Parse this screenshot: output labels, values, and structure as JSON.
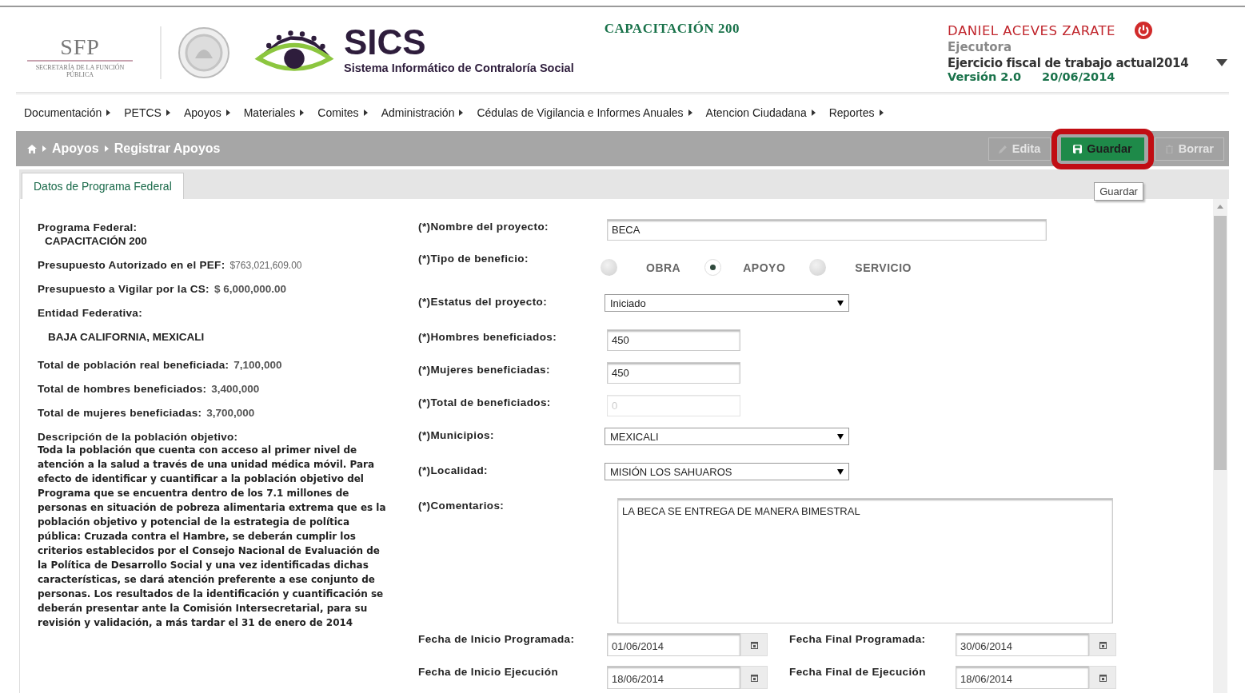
{
  "header": {
    "agency": "SFP",
    "agency_subtitle": "SECRETARÍA DE LA FUNCIÓN PÚBLICA",
    "app_name": "SICS",
    "app_subtitle": "Sistema Informático de Contraloría Social",
    "program": "CAPACITACIÓN 200",
    "user": {
      "name": "DANIEL ACEVES ZARATE",
      "role": "Ejecutora",
      "fiscal_year": "Ejercicio fiscal de trabajo actual2014",
      "version": "Versión 2.0",
      "date": "20/06/2014"
    }
  },
  "menu": [
    "Documentación",
    "PETCS",
    "Apoyos",
    "Materiales",
    "Comites",
    "Administración",
    "Cédulas de Vigilancia e Informes Anuales",
    "Atencion Ciudadana",
    "Reportes"
  ],
  "breadcrumb": [
    "Apoyos",
    "Registrar Apoyos"
  ],
  "toolbar": [
    {
      "kind": "edit",
      "label": "Edita",
      "disabled": true,
      "highlighted": false
    },
    {
      "kind": "save",
      "label": "Guardar",
      "disabled": false,
      "highlighted": true
    },
    {
      "kind": "delete",
      "label": "Borrar",
      "disabled": true,
      "highlighted": false
    }
  ],
  "tooltip": "Guardar",
  "tabs": [
    {
      "label": "Datos de Programa Federal",
      "selected": true
    }
  ],
  "summary": {
    "program_label": "Programa Federal:",
    "program_value": "CAPACITACIÓN 200",
    "items": [
      {
        "label": "Presupuesto Autorizado en el PEF:",
        "value": "$763,021,609.00"
      },
      {
        "label": "Presupuesto a Vigilar por la CS:",
        "value": "$ 6,000,000.00"
      }
    ],
    "entity_label": "Entidad Federativa:",
    "entity_value": "BAJA CALIFORNIA, MEXICALI",
    "totals": [
      {
        "label": "Total de población real beneficiada:",
        "value": "7,100,000"
      },
      {
        "label": "Total de hombres beneficiados:",
        "value": "3,400,000"
      },
      {
        "label": "Total de mujeres beneficiadas:",
        "value": "3,700,000"
      }
    ],
    "description_label": "Descripción de la población objetivo:",
    "description": "Toda la población que cuenta con acceso al primer nivel de atención a la salud a través de una unidad médica móvil. Para efecto de identificar y cuantificar a la población objetivo del Programa que se encuentra dentro de los 7.1 millones de personas en situación de pobreza alimentaria extrema que es la población objetivo y potencial de la estrategia de política pública: Cruzada contra el Hambre, se deberán cumplir los criterios establecidos por el Consejo Nacional de Evaluación de la Política de Desarrollo Social y una vez identificadas dichas características, se dará atención preferente a ese conjunto de personas. Los resultados de la identificación y cuantificación se deberán presentar ante la Comisión Intersecretarial, para su revisión y validación, a más tardar el 31 de enero de 2014"
  },
  "form": [
    {
      "kind": "text",
      "label": "(*)Nombre del proyecto:",
      "value": "BECA",
      "disabled": false
    },
    {
      "kind": "radio",
      "label": "(*)Tipo de beneficio:",
      "options": [
        {
          "label": "OBRA",
          "selected": false
        },
        {
          "label": "APOYO",
          "selected": true
        },
        {
          "label": "SERVICIO",
          "selected": false
        }
      ]
    },
    {
      "kind": "select",
      "label": "(*)Estatus del proyecto:",
      "value": "Iniciado"
    },
    {
      "kind": "number",
      "label": "(*)Hombres beneficiados:",
      "value": "450",
      "disabled": false
    },
    {
      "kind": "number",
      "label": "(*)Mujeres beneficiadas:",
      "value": "450",
      "disabled": false
    },
    {
      "kind": "number",
      "label": "(*)Total de beneficiados:",
      "value": "0",
      "disabled": true
    },
    {
      "kind": "select",
      "label": "(*)Municipios:",
      "value": "MEXICALI"
    },
    {
      "kind": "select",
      "label": "(*)Localidad:",
      "value": "MISIÓN LOS SAHUAROS"
    },
    {
      "kind": "textarea",
      "label": "(*)Comentarios:",
      "value": "LA BECA SE ENTREGA DE MANERA BIMESTRAL"
    }
  ],
  "dates": [
    {
      "label": "Fecha de Inicio Programada:",
      "value": "01/06/2014"
    },
    {
      "label": "Fecha Final Programada:",
      "value": "30/06/2014"
    },
    {
      "label": "Fecha de Inicio Ejecución",
      "value": "18/06/2014"
    },
    {
      "label": "Fecha Final de Ejecución",
      "value": "18/06/2014"
    }
  ]
}
